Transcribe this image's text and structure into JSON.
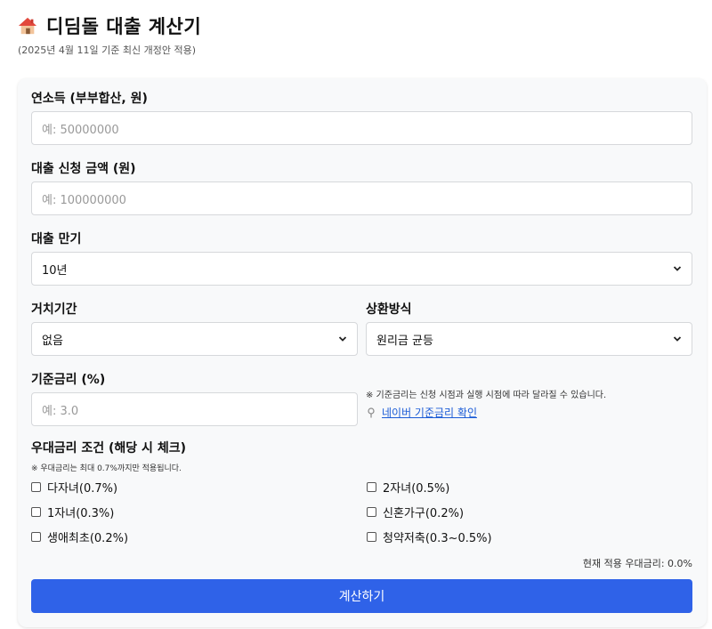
{
  "header": {
    "title": "디딤돌 대출 계산기",
    "subtitle": "(2025년 4월 11일 기준 최신 개정안 적용)"
  },
  "form": {
    "income": {
      "label": "연소득 (부부합산, 원)",
      "placeholder": "예: 50000000"
    },
    "amount": {
      "label": "대출 신청 금액 (원)",
      "placeholder": "예: 100000000"
    },
    "term": {
      "label": "대출 만기",
      "value": "10년"
    },
    "grace": {
      "label": "거치기간",
      "value": "없음"
    },
    "repay": {
      "label": "상환방식",
      "value": "원리금 균등"
    },
    "base_rate": {
      "label": "기준금리 (%)",
      "placeholder": "예: 3.0",
      "note": "※ 기준금리는 신청 시점과 실행 시점에 따라 달라질 수 있습니다.",
      "link": "네이버 기준금리 확인"
    },
    "preferential": {
      "title": "우대금리 조건 (해당 시 체크)",
      "note": "※ 우대금리는 최대 0.7%까지만 적용됩니다.",
      "options": [
        {
          "label": "다자녀(0.7%)",
          "checked": false
        },
        {
          "label": "2자녀(0.5%)",
          "checked": false
        },
        {
          "label": "1자녀(0.3%)",
          "checked": false
        },
        {
          "label": "신혼가구(0.2%)",
          "checked": false
        },
        {
          "label": "생애최초(0.2%)",
          "checked": false
        },
        {
          "label": "청약저축(0.3~0.5%)",
          "checked": false
        }
      ],
      "current_label": "현재 적용 우대금리:",
      "current_value": "0.0%"
    },
    "submit_label": "계산하기"
  },
  "colors": {
    "primary": "#2f62e8",
    "link": "#1a5bd6",
    "card_bg": "#f8f9fa"
  },
  "icons": {
    "title": "house-icon",
    "link": "pin-icon",
    "select": "chevron-down-icon"
  }
}
